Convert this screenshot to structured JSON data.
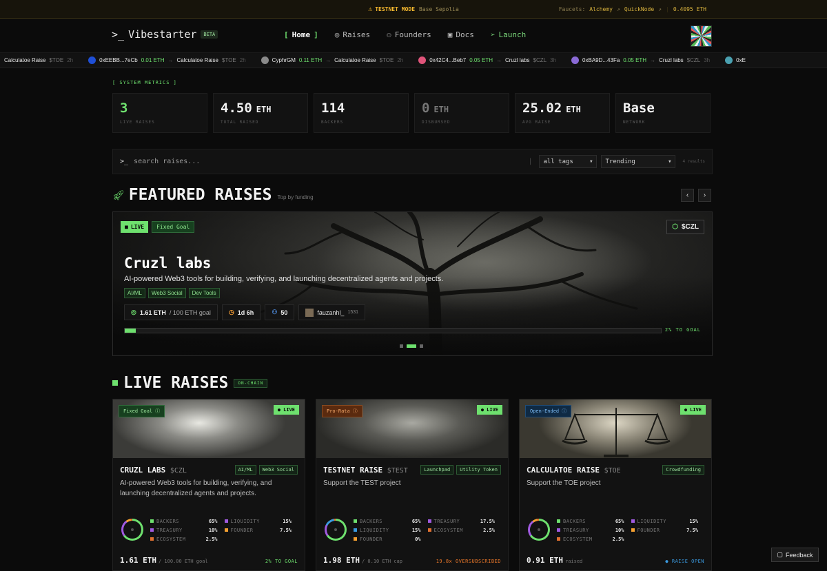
{
  "banner": {
    "mode": "TESTNET MODE",
    "network": "Base Sepolia",
    "faucets_label": "Faucets:",
    "faucets": [
      "Alchemy",
      "QuickNode"
    ],
    "balance": "0.4095 ETH"
  },
  "nav": {
    "logo_prompt": ">_",
    "logo_text": "Vibestarter",
    "beta": "BETA",
    "items": [
      {
        "label": "Home",
        "active": true
      },
      {
        "label": "Raises"
      },
      {
        "label": "Founders"
      },
      {
        "label": "Docs"
      },
      {
        "label": "Launch"
      }
    ]
  },
  "ticker": [
    {
      "user": "",
      "amount": "",
      "target": "Calculatoe Raise",
      "symbol": "$TOE",
      "ago": "2h",
      "color": ""
    },
    {
      "user": "0xEEBB...7eCb",
      "amount": "0.01 ETH",
      "target": "Calculatoe Raise",
      "symbol": "$TOE",
      "ago": "2h",
      "color": "#1f4fd6"
    },
    {
      "user": "CyphrGM",
      "amount": "0.11 ETH",
      "target": "Calculatoe Raise",
      "symbol": "$TOE",
      "ago": "2h",
      "color": "#8a8a8a"
    },
    {
      "user": "0x42C4...Beb7",
      "amount": "0.05 ETH",
      "target": "Cruzl labs",
      "symbol": "$CZL",
      "ago": "3h",
      "color": "#e0547a"
    },
    {
      "user": "0xBA9D...43Fa",
      "amount": "0.05 ETH",
      "target": "Cruzl labs",
      "symbol": "$CZL",
      "ago": "3h",
      "color": "#8a6ad6"
    },
    {
      "user": "0xE",
      "amount": "",
      "target": "",
      "symbol": "",
      "ago": "",
      "color": "#4aa0b0"
    }
  ],
  "metrics": {
    "label": "[ SYSTEM METRICS ]",
    "items": [
      {
        "value": "3",
        "unit": "",
        "label": "LIVE RAISES"
      },
      {
        "value": "4.50",
        "unit": "ETH",
        "label": "TOTAL RAISED"
      },
      {
        "value": "114",
        "unit": "",
        "label": "BACKERS"
      },
      {
        "value": "0",
        "unit": "ETH",
        "label": "DISBURSED"
      },
      {
        "value": "25.02",
        "unit": "ETH",
        "label": "AVG RAISE"
      },
      {
        "value": "Base",
        "unit": "",
        "label": "NETWORK"
      }
    ]
  },
  "search": {
    "prompt": ">_",
    "placeholder": "search raises...",
    "tags_value": "all tags",
    "sort_value": "Trending",
    "results": "4 results"
  },
  "featured": {
    "title": "FEATURED RAISES",
    "subtitle": "Top by funding",
    "live": "LIVE",
    "goal_type": "Fixed Goal",
    "ticker": "$CZL",
    "name": "Cruzl labs",
    "description": "AI-powered Web3 tools for building, verifying, and launching decentralized agents and projects.",
    "tags": [
      "AI/ML",
      "Web3 Social",
      "Dev Tools"
    ],
    "raised": "1.61 ETH",
    "goal": "/ 100 ETH goal",
    "time_left": "1d 6h",
    "backers": "50",
    "founder": "fauzanhl_",
    "founder_score": "1531",
    "progress": 0.02,
    "progress_label": "2% TO GOAL"
  },
  "live": {
    "title": "LIVE RAISES",
    "badge": "ON-CHAIN",
    "cards": [
      {
        "type": "Fixed Goal",
        "status": "LIVE",
        "name": "CRUZL LABS",
        "ticker": "$CZL",
        "tags": [
          "AI/ML",
          "Web3 Social"
        ],
        "description": "AI-powered Web3 tools for building, verifying, and launching decentralized agents and projects.",
        "alloc": [
          {
            "k": "BACKERS",
            "v": "65%",
            "color": "#6ee06e"
          },
          {
            "k": "LIQUIDITY",
            "v": "15%",
            "color": "#a05ae0"
          },
          {
            "k": "TREASURY",
            "v": "10%",
            "color": "#a05ae0"
          },
          {
            "k": "FOUNDER",
            "v": "7.5%",
            "color": "#f5a030"
          },
          {
            "k": "ECOSYSTEM",
            "v": "2.5%",
            "color": "#e07030"
          }
        ],
        "amount": "1.61 ETH",
        "amount_note": "/ 100.00 ETH goal",
        "status_note": "2% TO GOAL",
        "status_color": "#6ee06e"
      },
      {
        "type": "Pro-Rata",
        "status": "LIVE",
        "name": "TESTNET RAISE",
        "ticker": "$TEST",
        "tags": [
          "Launchpad",
          "Utility Token"
        ],
        "description": "Support the TEST project",
        "alloc": [
          {
            "k": "BACKERS",
            "v": "65%",
            "color": "#6ee06e"
          },
          {
            "k": "TREASURY",
            "v": "17.5%",
            "color": "#a05ae0"
          },
          {
            "k": "LIQUIDITY",
            "v": "15%",
            "color": "#3a9ae0"
          },
          {
            "k": "ECOSYSTEM",
            "v": "2.5%",
            "color": "#e07030"
          },
          {
            "k": "FOUNDER",
            "v": "0%",
            "color": "#f5a030"
          }
        ],
        "amount": "1.98 ETH",
        "amount_note": "/ 0.10 ETH cap",
        "status_note": "19.8x OVERSUBSCRIBED",
        "status_color": "#f07a2a"
      },
      {
        "type": "Open-Ended",
        "status": "LIVE",
        "name": "CALCULATOE RAISE",
        "ticker": "$TOE",
        "tags": [
          "Crowdfunding"
        ],
        "description": "Support the TOE project",
        "alloc": [
          {
            "k": "BACKERS",
            "v": "65%",
            "color": "#6ee06e"
          },
          {
            "k": "LIQUIDITY",
            "v": "15%",
            "color": "#a05ae0"
          },
          {
            "k": "TREASURY",
            "v": "10%",
            "color": "#a05ae0"
          },
          {
            "k": "FOUNDER",
            "v": "7.5%",
            "color": "#f5a030"
          },
          {
            "k": "ECOSYSTEM",
            "v": "2.5%",
            "color": "#e07030"
          }
        ],
        "amount": "0.91 ETH",
        "amount_note": "raised",
        "status_note": "● RAISE OPEN",
        "status_color": "#3a9ae0"
      }
    ]
  },
  "feedback": "Feedback"
}
